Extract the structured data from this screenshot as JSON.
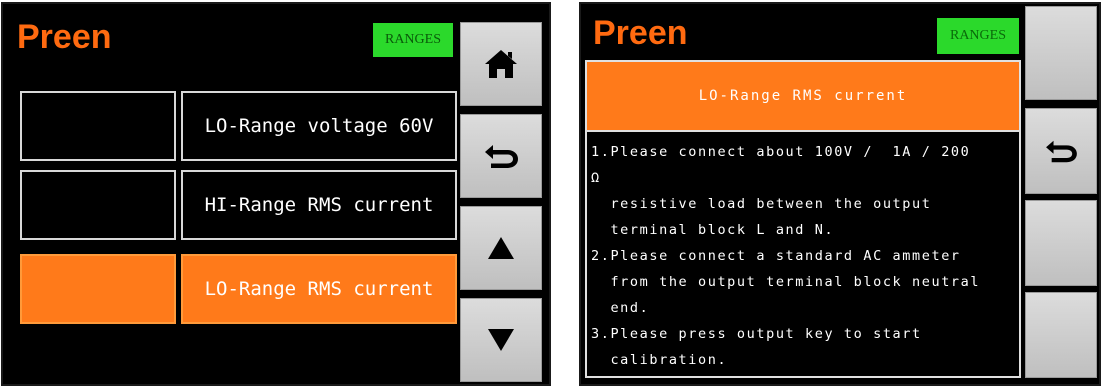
{
  "left_screen": {
    "logo": "Preen",
    "ranges_button": "RANGES",
    "items": [
      {
        "label": "LO-Range voltage 60V"
      },
      {
        "label": "HI-Range RMS current"
      },
      {
        "label": "LO-Range RMS current"
      }
    ],
    "side_buttons": [
      "home-icon",
      "back-arrow-icon",
      "up-triangle-icon",
      "down-triangle-icon"
    ]
  },
  "right_screen": {
    "logo": "Preen",
    "ranges_button": "RANGES",
    "title": "LO-Range RMS current",
    "instructions": [
      "1.Please connect about 100V /  1A / 200",
      "Ω",
      "  resistive load between the output",
      "  terminal block L and N.",
      "2.Please connect a standard AC ammeter",
      "  from the output terminal block neutral",
      "  end.",
      "3.Please press output key to start",
      "  calibration."
    ],
    "side_buttons": [
      "blank",
      "back-arrow-icon",
      "blank",
      "blank"
    ]
  },
  "colors": {
    "selected": "#ff7a1a",
    "ranges_green": "#2bd92b",
    "screen_bg": "#000000"
  }
}
